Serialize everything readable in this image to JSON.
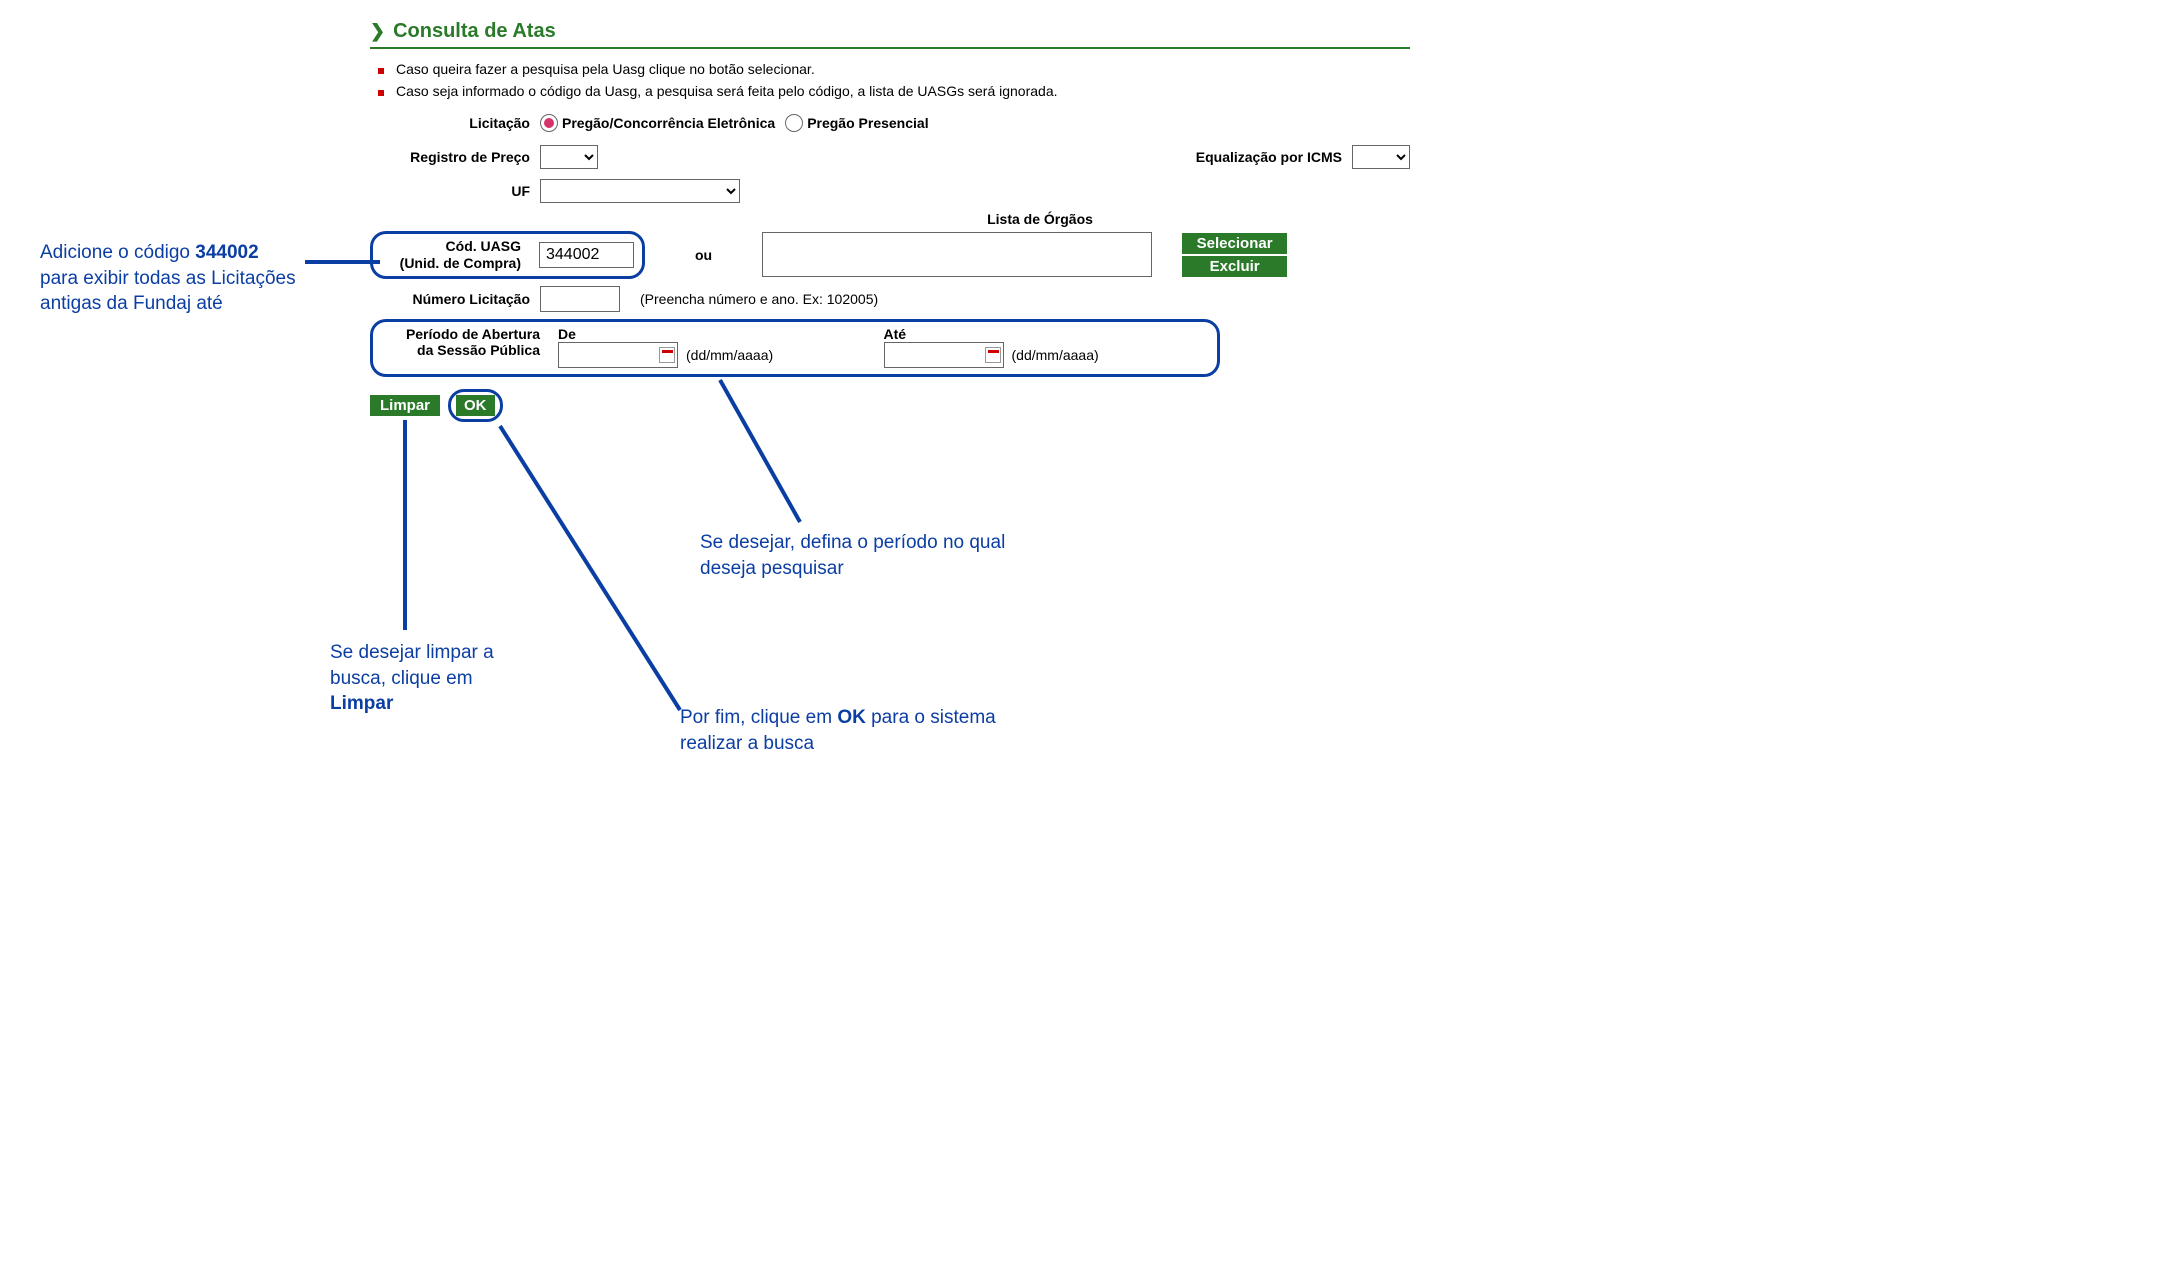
{
  "header": {
    "title": "Consulta de Atas"
  },
  "tips": [
    "Caso queira fazer a pesquisa pela Uasg clique no botão selecionar.",
    "Caso seja informado o código da Uasg, a pesquisa será feita pelo código, a lista de UASGs será ignorada."
  ],
  "form": {
    "licitacao": {
      "label": "Licitação",
      "opt1": "Pregão/Concorrência Eletrônica",
      "opt2": "Pregão Presencial",
      "selected": "opt1"
    },
    "registro_preco": {
      "label": "Registro de Preço"
    },
    "equalizacao": {
      "label": "Equalização por ICMS"
    },
    "uf": {
      "label": "UF"
    },
    "cod_uasg": {
      "label_line1": "Cód. UASG",
      "label_line2": "(Unid. de Compra)",
      "value": "344002"
    },
    "ou": "ou",
    "lista_orgaos": {
      "header": "Lista de Órgãos"
    },
    "selecionar": "Selecionar",
    "excluir": "Excluir",
    "numero_licitacao": {
      "label": "Número Licitação",
      "hint": "(Preencha número e ano. Ex: 102005)"
    },
    "periodo": {
      "label_line1": "Período de Abertura",
      "label_line2": "da Sessão Pública",
      "de": "De",
      "ate": "Até",
      "format": "(dd/mm/aaaa)"
    },
    "limpar": "Limpar",
    "ok": "OK"
  },
  "annotations": {
    "cod_uasg": {
      "line1_a": "Adicione o código ",
      "line1_b": "344002",
      "line2": "para exibir todas as Licitações",
      "line3": "antigas da Fundaj até"
    },
    "periodo": {
      "line1": "Se desejar, defina o período no qual",
      "line2": "deseja pesquisar"
    },
    "ok": {
      "line1_a": "Por fim, clique em ",
      "line1_b": "OK",
      "line1_c": " para o sistema",
      "line2": "realizar  a busca"
    },
    "limpar": {
      "line1": "Se desejar limpar a",
      "line2": "busca, clique em",
      "line3": "Limpar"
    }
  }
}
